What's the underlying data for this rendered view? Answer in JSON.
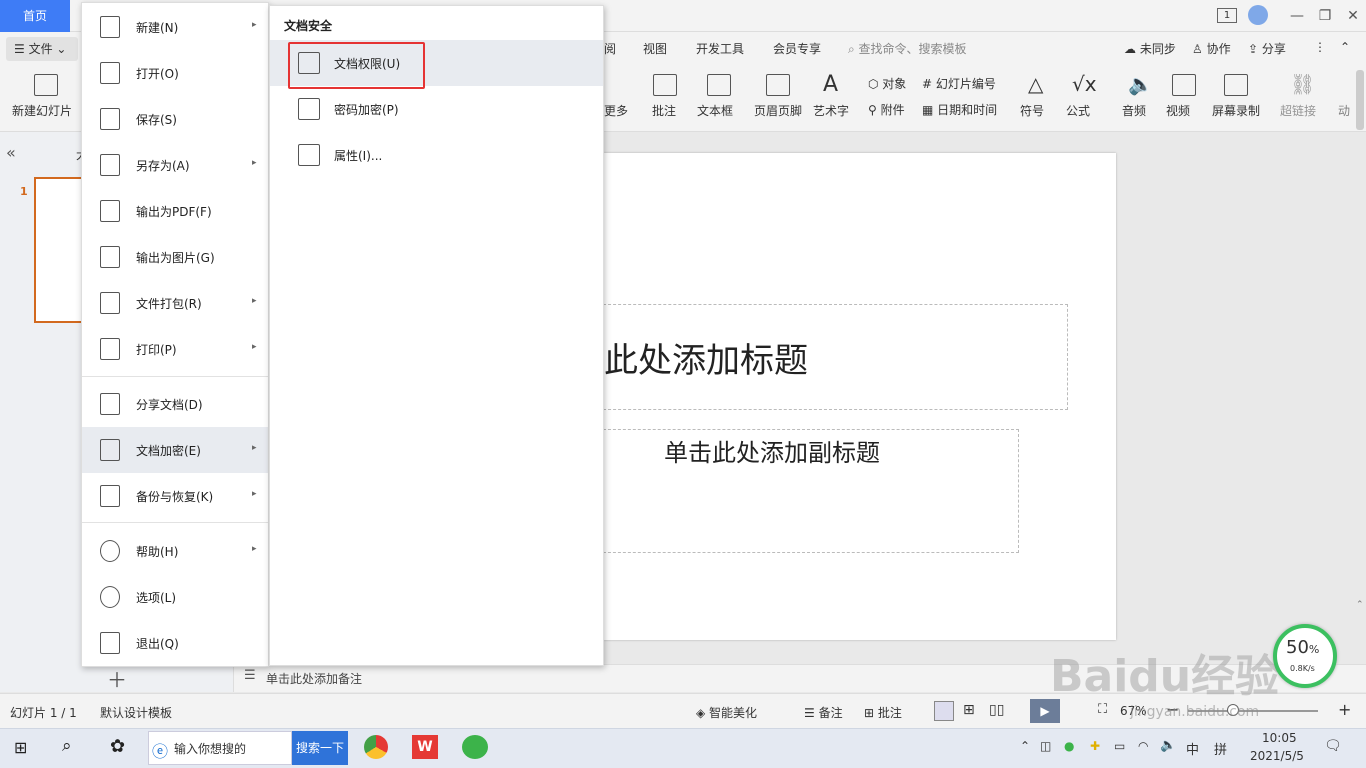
{
  "titlebar": {
    "home_tab": "首页",
    "page_badge": "1"
  },
  "menubar": {
    "file_label": "文件",
    "tabs": [
      "阅",
      "视图",
      "开发工具",
      "会员专享"
    ],
    "search_placeholder": "查找命令、搜索模板",
    "sync_label": "未同步",
    "collab_label": "协作",
    "share_label": "分享"
  },
  "ribbon": {
    "new_slide": "新建幻灯片",
    "more": "更多",
    "comment": "批注",
    "textbox": "文本框",
    "header_footer": "页眉页脚",
    "wordart": "艺术字",
    "object": "对象",
    "attachment": "附件",
    "slide_number": "幻灯片编号",
    "datetime": "日期和时间",
    "symbol": "符号",
    "formula": "公式",
    "audio": "音频",
    "video": "视频",
    "screen_record": "屏幕录制",
    "hyperlink": "超链接",
    "animation": "动"
  },
  "left_panel": {
    "collapse": "«",
    "outline_char": "大",
    "slide_index": "1"
  },
  "slide": {
    "title_placeholder": "此处添加标题",
    "subtitle_placeholder": "单击此处添加副标题"
  },
  "notes": {
    "placeholder": "单击此处添加备注"
  },
  "file_menu": {
    "items": [
      {
        "label": "新建(N)",
        "arrow": "▸"
      },
      {
        "label": "打开(O)",
        "arrow": ""
      },
      {
        "label": "保存(S)",
        "arrow": ""
      },
      {
        "label": "另存为(A)",
        "arrow": "▸"
      },
      {
        "label": "输出为PDF(F)",
        "arrow": ""
      },
      {
        "label": "输出为图片(G)",
        "arrow": ""
      },
      {
        "label": "文件打包(R)",
        "arrow": "▸"
      },
      {
        "label": "打印(P)",
        "arrow": "▸"
      },
      {
        "label": "分享文档(D)",
        "arrow": ""
      },
      {
        "label": "文档加密(E)",
        "arrow": "▸"
      },
      {
        "label": "备份与恢复(K)",
        "arrow": "▸"
      },
      {
        "label": "帮助(H)",
        "arrow": "▸"
      },
      {
        "label": "选项(L)",
        "arrow": ""
      },
      {
        "label": "退出(Q)",
        "arrow": ""
      }
    ]
  },
  "submenu": {
    "heading": "文档安全",
    "items": [
      {
        "label": "文档权限(U)"
      },
      {
        "label": "密码加密(P)"
      },
      {
        "label": "属性(I)..."
      }
    ]
  },
  "statusbar": {
    "slide_count": "幻灯片 1 / 1",
    "template": "默认设计模板",
    "smart_beautify": "智能美化",
    "notes": "备注",
    "comments": "批注",
    "zoom": "67%"
  },
  "taskbar": {
    "search_text": "输入你想搜的",
    "search_button": "搜索一下",
    "ime_lang": "中",
    "ime_mode": "拼",
    "time": "10:05",
    "date": "2021/5/5"
  },
  "perf_widget": {
    "percent": "50",
    "unit": "%",
    "rate": "0.8K/s"
  },
  "watermark": {
    "brand": "Baidu经验",
    "url": "jingyan.baidu.com"
  },
  "colors": {
    "accent": "#3e7cf6",
    "highlight_box": "#e53333",
    "thumb_border": "#d2691e",
    "perf_ring": "#3cc060"
  }
}
